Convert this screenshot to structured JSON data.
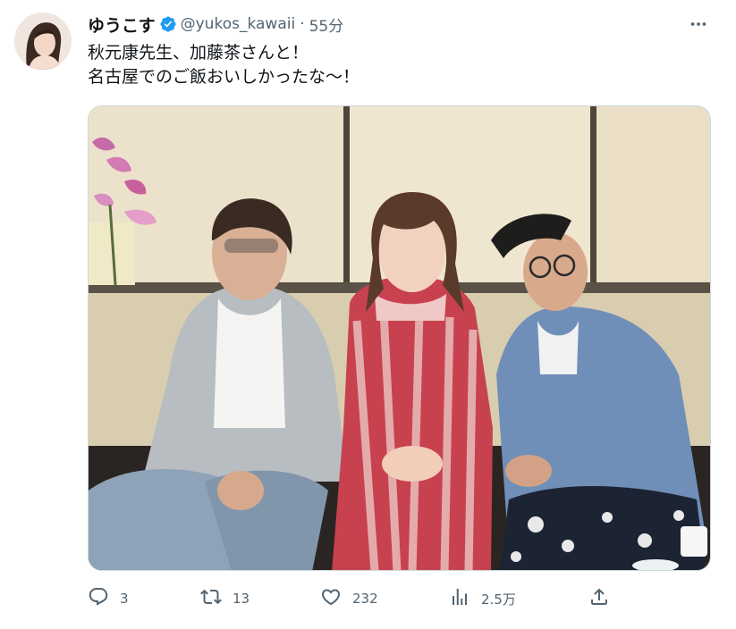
{
  "user": {
    "display_name": "ゆうこす",
    "handle": "@yukos_kawaii",
    "separator": "·",
    "time": "55分"
  },
  "tweet": {
    "lines": [
      "秋元康先生、加藤茶さんと！",
      "名古屋でのご飯おいしかったな〜！"
    ]
  },
  "icons": {
    "verified": "verified-badge-icon",
    "more": "more-icon",
    "reply": "reply-icon",
    "retweet": "retweet-icon",
    "like": "like-icon",
    "views": "views-icon",
    "share": "share-icon"
  },
  "colors": {
    "verified": "#1d9bf0",
    "icon_gray": "#536471",
    "text": "#0f1419"
  },
  "actions": {
    "reply_count": "3",
    "retweet_count": "13",
    "like_count": "232",
    "views_count": "2.5万"
  }
}
